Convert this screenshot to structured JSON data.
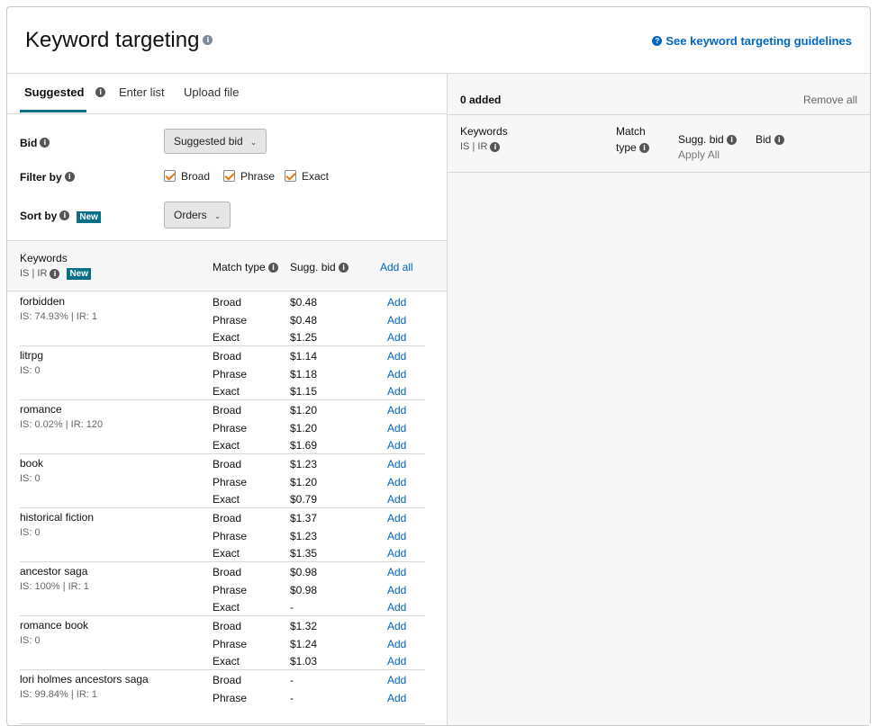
{
  "header": {
    "title": "Keyword targeting",
    "guide_link": "See keyword targeting guidelines"
  },
  "tabs": [
    {
      "label": "Suggested"
    },
    {
      "label": "Enter list"
    },
    {
      "label": "Upload file"
    }
  ],
  "form": {
    "bid_label": "Bid",
    "bid_value": "Suggested bid",
    "filter_label": "Filter by",
    "filters": [
      {
        "label": "Broad",
        "checked": true
      },
      {
        "label": "Phrase",
        "checked": true
      },
      {
        "label": "Exact",
        "checked": true
      }
    ],
    "sort_label": "Sort by",
    "new_badge": "New",
    "sort_value": "Orders"
  },
  "table": {
    "col_keywords": "Keywords",
    "col_is": "IS",
    "col_sep": "|",
    "col_ir": "IR",
    "new_badge": "New",
    "col_match": "Match type",
    "col_bid": "Sugg. bid",
    "add_all": "Add all",
    "add_label": "Add",
    "groups": [
      {
        "keyword": "forbidden",
        "stats": "IS: 74.93% | IR: 1",
        "rows": [
          {
            "match": "Broad",
            "bid": "$0.48"
          },
          {
            "match": "Phrase",
            "bid": "$0.48"
          },
          {
            "match": "Exact",
            "bid": "$1.25"
          }
        ]
      },
      {
        "keyword": "litrpg",
        "stats": "IS: 0",
        "rows": [
          {
            "match": "Broad",
            "bid": "$1.14"
          },
          {
            "match": "Phrase",
            "bid": "$1.18"
          },
          {
            "match": "Exact",
            "bid": "$1.15"
          }
        ]
      },
      {
        "keyword": "romance",
        "stats": "IS: 0.02% | IR: 120",
        "rows": [
          {
            "match": "Broad",
            "bid": "$1.20"
          },
          {
            "match": "Phrase",
            "bid": "$1.20"
          },
          {
            "match": "Exact",
            "bid": "$1.69"
          }
        ]
      },
      {
        "keyword": "book",
        "stats": "IS: 0",
        "rows": [
          {
            "match": "Broad",
            "bid": "$1.23"
          },
          {
            "match": "Phrase",
            "bid": "$1.20"
          },
          {
            "match": "Exact",
            "bid": "$0.79"
          }
        ]
      },
      {
        "keyword": "historical fiction",
        "stats": "IS: 0",
        "rows": [
          {
            "match": "Broad",
            "bid": "$1.37"
          },
          {
            "match": "Phrase",
            "bid": "$1.23"
          },
          {
            "match": "Exact",
            "bid": "$1.35"
          }
        ]
      },
      {
        "keyword": "ancestor saga",
        "stats": "IS: 100% | IR: 1",
        "rows": [
          {
            "match": "Broad",
            "bid": "$0.98"
          },
          {
            "match": "Phrase",
            "bid": "$0.98"
          },
          {
            "match": "Exact",
            "bid": "-"
          }
        ]
      },
      {
        "keyword": "romance book",
        "stats": "IS: 0",
        "rows": [
          {
            "match": "Broad",
            "bid": "$1.32"
          },
          {
            "match": "Phrase",
            "bid": "$1.24"
          },
          {
            "match": "Exact",
            "bid": "$1.03"
          }
        ]
      },
      {
        "keyword": "lori holmes ancestors saga",
        "stats": "IS: 99.84% | IR: 1",
        "rows": [
          {
            "match": "Broad",
            "bid": "-"
          },
          {
            "match": "Phrase",
            "bid": "-"
          }
        ]
      }
    ]
  },
  "added": {
    "count_label": "0 added",
    "remove_all": "Remove all",
    "col_keywords": "Keywords",
    "col_is": "IS",
    "col_sep": "|",
    "col_ir": "IR",
    "col_match_1": "Match",
    "col_match_2": "type",
    "col_sugg": "Sugg. bid",
    "apply_all": "Apply All",
    "col_bid": "Bid"
  }
}
